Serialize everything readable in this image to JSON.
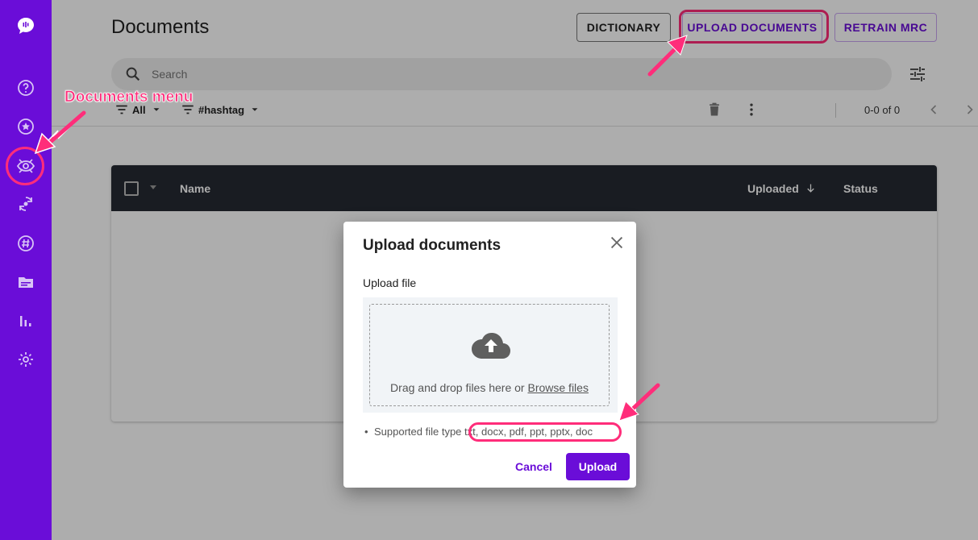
{
  "page": {
    "title": "Documents",
    "buttons": {
      "dictionary": "DICTIONARY",
      "upload_documents": "UPLOAD DOCUMENTS",
      "retrain_mrc": "RETRAIN MRC"
    },
    "search": {
      "placeholder": "Search"
    },
    "filters": {
      "all_label": "All",
      "hashtag_label": "#hashtag"
    },
    "pagination": "0-0 of 0",
    "table": {
      "columns": [
        "Name",
        "Uploaded",
        "Status"
      ]
    }
  },
  "sidebar": {
    "icons": [
      "logo-icon",
      "help-icon",
      "star-icon",
      "eye-icon",
      "sync-icon",
      "hashtag-icon",
      "folder-icon",
      "chart-icon",
      "settings-icon"
    ],
    "active": "eye-icon"
  },
  "dialog": {
    "title": "Upload documents",
    "upload_label": "Upload file",
    "drop_text": "Drag and drop files here or ",
    "browse_link": "Browse files",
    "supported_prefix": "Supported file type",
    "supported_types": "txt, docx, pdf, ppt, pptx, doc",
    "cancel": "Cancel",
    "upload": "Upload"
  },
  "annotations": {
    "documents_menu": "Documents menu",
    "highlight_color": "#ff2d7a"
  },
  "colors": {
    "brand": "#6a0dd8",
    "header_dark": "#262a33"
  }
}
